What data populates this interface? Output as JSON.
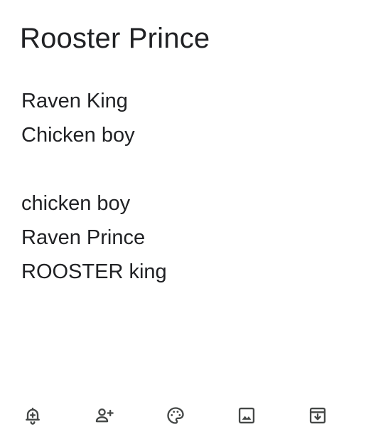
{
  "note": {
    "title": "Rooster Prince",
    "lines": [
      "Raven King",
      "Chicken boy",
      "",
      "chicken boy",
      "Raven Prince",
      "ROOSTER king"
    ]
  },
  "toolbar": {
    "icons": [
      "remind-me-icon",
      "collaborator-icon",
      "background-options-icon",
      "add-image-icon",
      "archive-icon"
    ]
  },
  "colors": {
    "text": "#202124",
    "icon": "#444746",
    "background": "#ffffff"
  }
}
